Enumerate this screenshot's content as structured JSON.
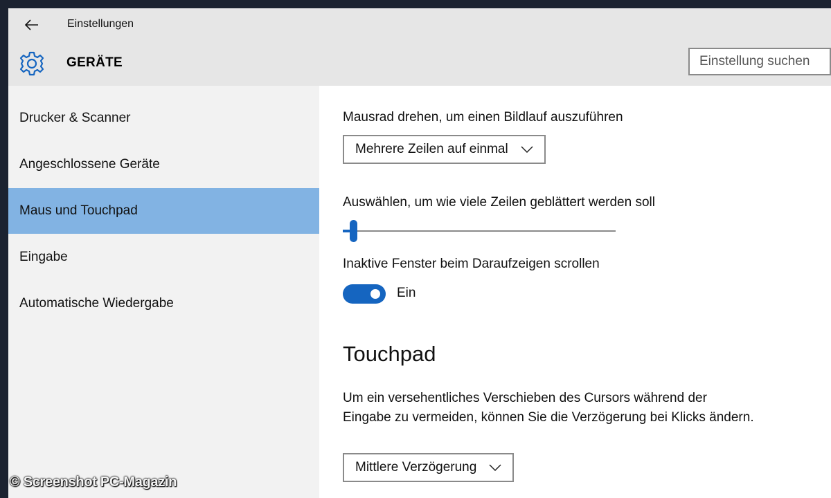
{
  "window": {
    "title": "Einstellungen"
  },
  "header": {
    "page_title": "GERÄTE",
    "search_placeholder": "Einstellung suchen",
    "accent_color": "#1565c0"
  },
  "sidebar": {
    "items": [
      {
        "label": "Drucker & Scanner",
        "active": false
      },
      {
        "label": "Angeschlossene Geräte",
        "active": false
      },
      {
        "label": "Maus und Touchpad",
        "active": true
      },
      {
        "label": "Eingabe",
        "active": false
      },
      {
        "label": "Automatische Wiedergabe",
        "active": false
      }
    ],
    "active_color": "#82b3e3"
  },
  "content": {
    "scroll_label": "Mausrad drehen, um einen Bildlauf auszuführen",
    "scroll_value": "Mehrere Zeilen auf einmal",
    "lines_label": "Auswählen, um wie viele Zeilen geblättert werden soll",
    "lines_slider_fraction": 0.03,
    "inactive_label": "Inaktive Fenster beim Daraufzeigen scrollen",
    "inactive_toggle_state": "Ein",
    "touchpad_title": "Touchpad",
    "touchpad_description": "Um ein versehentliches Verschieben des Cursors während der Eingabe zu vermeiden, können Sie die Verzögerung bei Klicks ändern.",
    "delay_value": "Mittlere Verzögerung"
  },
  "watermark": "© Screenshot PC-Magazin",
  "icons": [
    "back-arrow-icon",
    "gear-icon",
    "chevron-down-icon"
  ]
}
